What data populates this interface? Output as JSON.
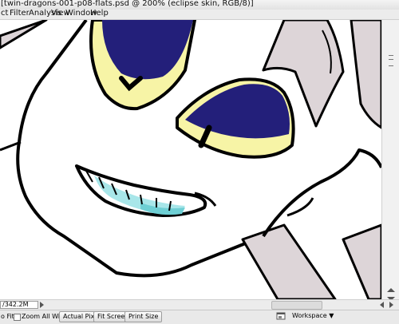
{
  "window": {
    "title": "[twin-dragons-001-p08-flats.psd @ 200% (eclipse skin, RGB/8)]"
  },
  "menu": {
    "items": [
      "ct",
      "Filter",
      "Analysis",
      "View",
      "Window",
      "Help"
    ]
  },
  "canvas": {
    "colors": {
      "outline": "#000000",
      "skin": "#ffffff",
      "eye_white": "#f7f4a6",
      "iris": "#231f7a",
      "horn": "#ddd5d8",
      "mouth_shine": "#a8e6e9",
      "mouth_shade": "#6ecfd4"
    }
  },
  "statusbar": {
    "zoom_field": "/342.2M"
  },
  "bottombar": {
    "fit_label": "o Fit",
    "zoom_all_windows_label": "Zoom All Windows",
    "actual_pixels_label": "Actual Pixels",
    "fit_screen_label": "Fit Screen",
    "print_size_label": "Print Size",
    "workspace_label": "Workspace ▼"
  }
}
